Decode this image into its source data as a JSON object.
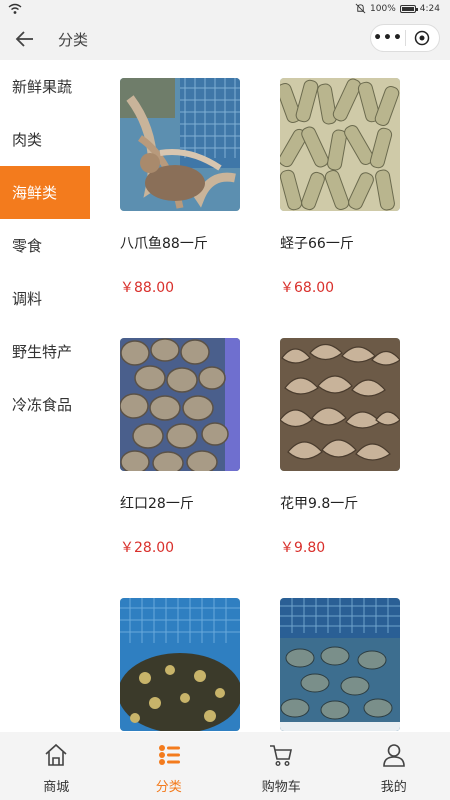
{
  "status_bar": {
    "battery": "100%",
    "time": "4:24"
  },
  "header": {
    "title": "分类",
    "more_label": "•••"
  },
  "sidebar": {
    "items": [
      {
        "label": "新鲜果蔬",
        "active": false
      },
      {
        "label": "肉类",
        "active": false
      },
      {
        "label": "海鲜类",
        "active": true
      },
      {
        "label": "零食",
        "active": false
      },
      {
        "label": "调料",
        "active": false
      },
      {
        "label": "野生特产",
        "active": false
      },
      {
        "label": "冷冻食品",
        "active": false
      }
    ]
  },
  "products": [
    {
      "name": "八爪鱼88一斤",
      "price": "￥88.00"
    },
    {
      "name": "蛏子66一斤",
      "price": "￥68.00"
    },
    {
      "name": "红口28一斤",
      "price": "￥28.00"
    },
    {
      "name": "花甲9.8一斤",
      "price": "￥9.80"
    },
    {
      "name": "",
      "price": ""
    },
    {
      "name": "",
      "price": ""
    }
  ],
  "tabbar": {
    "items": [
      {
        "label": "商城",
        "icon": "home-icon",
        "active": false
      },
      {
        "label": "分类",
        "icon": "category-list-icon",
        "active": true
      },
      {
        "label": "购物车",
        "icon": "cart-icon",
        "active": false
      },
      {
        "label": "我的",
        "icon": "user-icon",
        "active": false
      }
    ]
  },
  "colors": {
    "accent": "#f37b1d",
    "price": "#d9302c",
    "bar_bg": "#f2f2f2"
  }
}
